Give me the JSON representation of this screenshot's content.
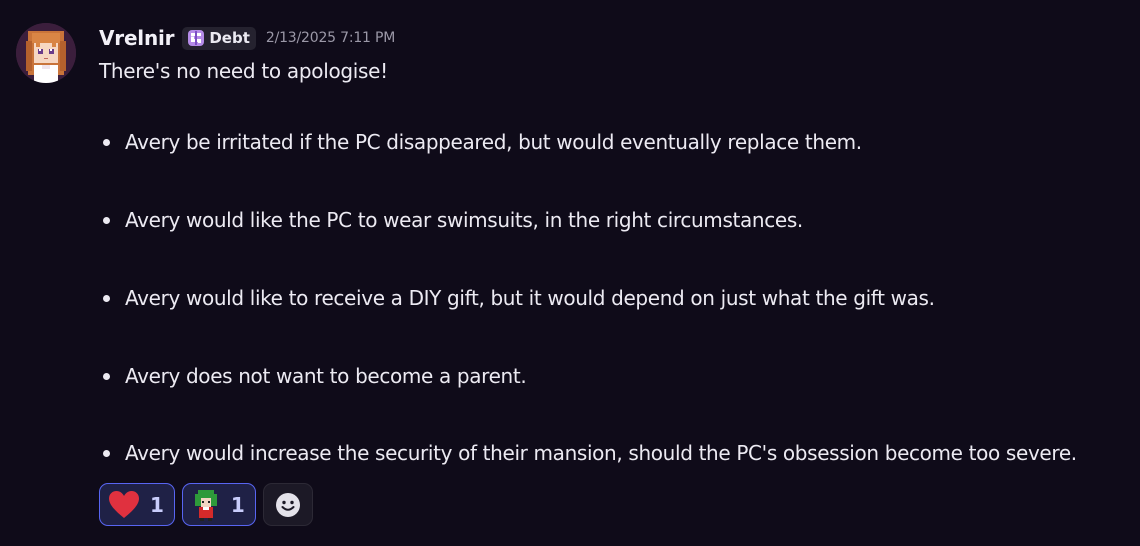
{
  "message": {
    "author": "Vrelnir",
    "tag": {
      "label": "Debt",
      "icon": "guild-tag-icon"
    },
    "timestamp": "2/13/2025 7:11 PM",
    "intro": "There's no need to apologise!",
    "bullets": [
      {
        "text": "Avery be irritated if the PC disappeared, but would eventually replace them."
      },
      {
        "text": "Avery would like the PC to wear swimsuits, in the right circumstances."
      },
      {
        "text": "Avery would like to receive a DIY gift, but it would depend on just what the gift was."
      },
      {
        "text": "Avery does not want to become a parent."
      },
      {
        "text": "Avery would increase the security of their mansion, should the PC's obsession become too severe."
      }
    ],
    "reactions": [
      {
        "emoji": "heart-icon",
        "count": "1"
      },
      {
        "emoji": "pixel-character-emoji",
        "count": "1"
      }
    ],
    "add_reaction_icon": "add-reaction-icon"
  },
  "colors": {
    "background": "#0f0b19",
    "reaction_border": "#5865f2",
    "reaction_bg": "#1f2146",
    "heart": "#e0313f"
  }
}
